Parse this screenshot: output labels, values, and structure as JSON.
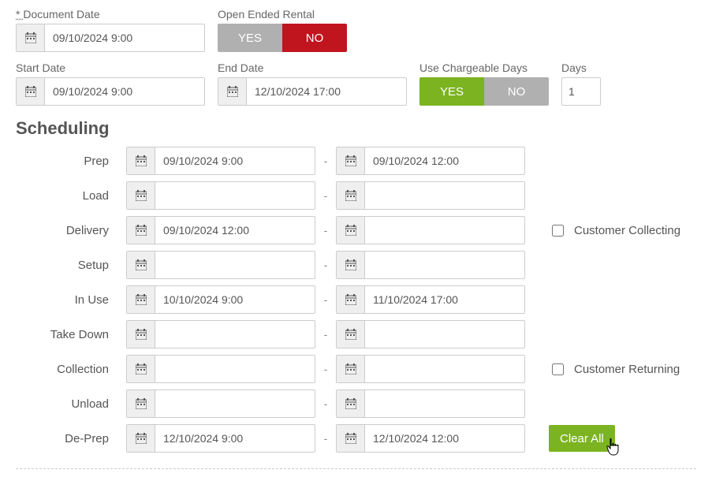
{
  "top": {
    "doc_date_label": "Document Date",
    "doc_date_value": "09/10/2024 9:00",
    "open_ended_label": "Open Ended Rental",
    "yes": "YES",
    "no": "NO"
  },
  "row2": {
    "start_label": "Start Date",
    "start_value": "09/10/2024 9:00",
    "end_label": "End Date",
    "end_value": "12/10/2024 17:00",
    "use_chargeable_label": "Use Chargeable Days",
    "days_label": "Days",
    "days_value": "1"
  },
  "scheduling_heading": "Scheduling",
  "rows": [
    {
      "label": "Prep",
      "from": "09/10/2024 9:00",
      "to": "09/10/2024 12:00"
    },
    {
      "label": "Load",
      "from": "",
      "to": ""
    },
    {
      "label": "Delivery",
      "from": "09/10/2024 12:00",
      "to": ""
    },
    {
      "label": "Setup",
      "from": "",
      "to": ""
    },
    {
      "label": "In Use",
      "from": "10/10/2024 9:00",
      "to": "11/10/2024 17:00"
    },
    {
      "label": "Take Down",
      "from": "",
      "to": ""
    },
    {
      "label": "Collection",
      "from": "",
      "to": ""
    },
    {
      "label": "Unload",
      "from": "",
      "to": ""
    },
    {
      "label": "De-Prep",
      "from": "12/10/2024 9:00",
      "to": "12/10/2024 12:00"
    }
  ],
  "customer_collecting_label": "Customer Collecting",
  "customer_returning_label": "Customer Returning",
  "clear_all_label": "Clear All"
}
